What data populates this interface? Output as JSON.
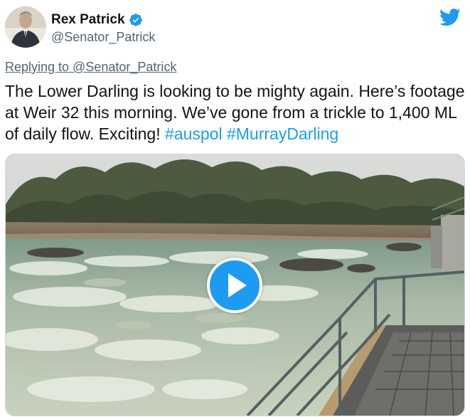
{
  "tweet": {
    "author": {
      "display_name": "Rex Patrick",
      "handle": "@Senator_Patrick",
      "verified": true,
      "avatar_icon": "user-avatar"
    },
    "brand_icon": "twitter-bird-icon",
    "brand_color": "#1d9bf0",
    "replying_to": "Replying to @Senator_Patrick",
    "text_parts": {
      "main": "The Lower Darling is looking to be mighty again. Here’s footage at Weir 32 this morning. We’ve gone from a trickle to 1,400 ML of daily flow. Exciting! ",
      "hashtag_1": "#auspol",
      "hashtag_2": "#MurrayDarling"
    },
    "media": {
      "type": "video",
      "play_icon": "play-icon"
    }
  }
}
